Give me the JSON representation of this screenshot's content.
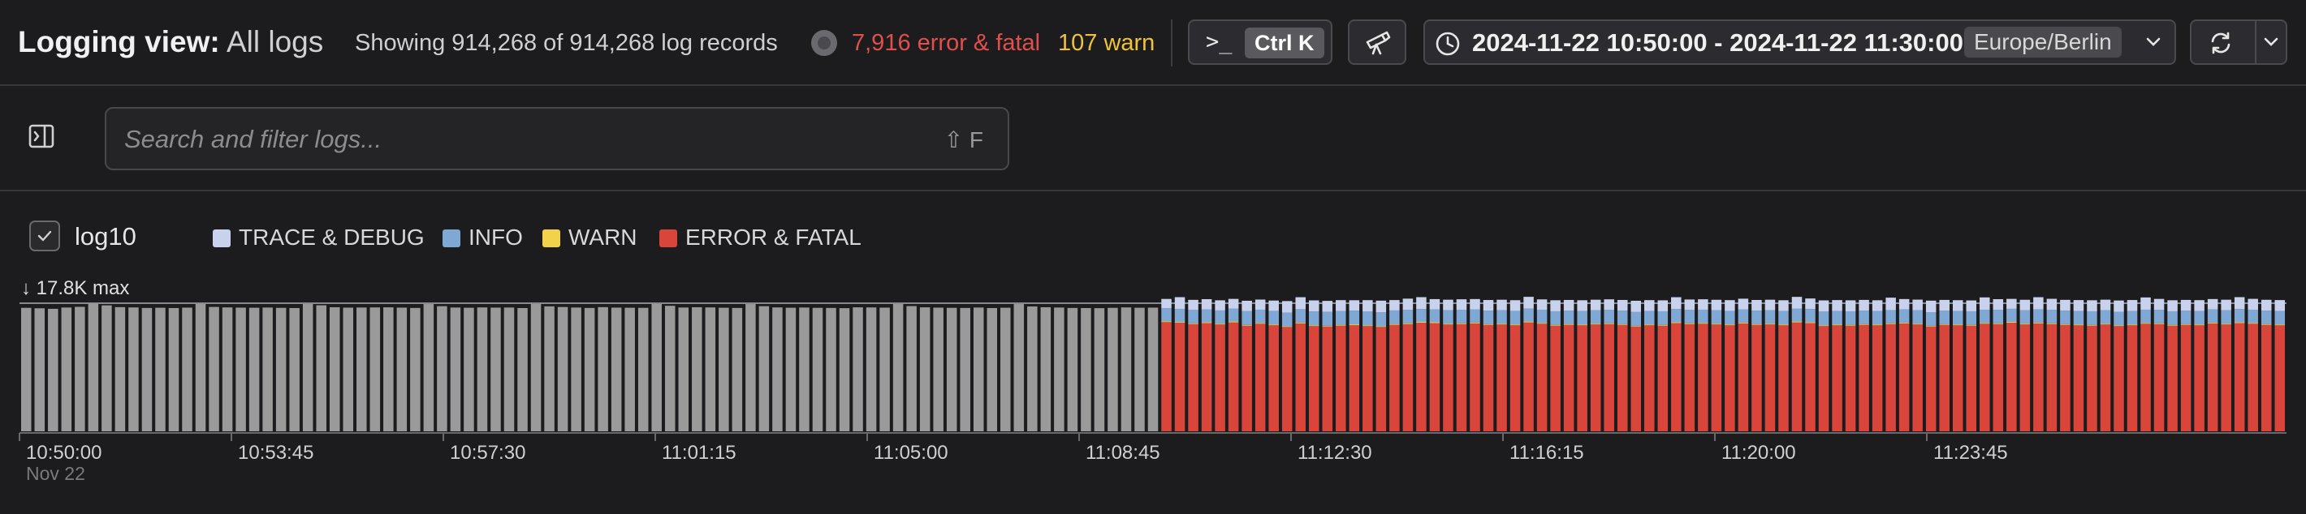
{
  "header": {
    "title_prefix": "Logging view:",
    "title_scope": "All logs",
    "showing_text": "Showing 914,268 of 914,268 log records",
    "error_text": "7,916 error & fatal",
    "warn_text": "107 warn",
    "cmd_prompt": ">_",
    "cmd_shortcut": "Ctrl K",
    "time_range": "2024-11-22 10:50:00 - 2024-11-22 11:30:00",
    "timezone": "Europe/Berlin"
  },
  "search": {
    "placeholder": "Search and filter logs...",
    "shortcut_hint": "⇧ F"
  },
  "icons": {
    "cmd": "terminal-icon",
    "scope": "telescope-icon",
    "time": "clock-icon",
    "refresh": "refresh-icon",
    "dropdown": "chevron-down-icon",
    "panel": "panel-toggle-icon",
    "checkbox": "check-icon"
  },
  "chart_controls": {
    "log10_label": "log10",
    "log10_checked": true,
    "max_label": "↓ 17.8K max"
  },
  "chart_data": {
    "type": "bar",
    "stacked": true,
    "scale": "log10",
    "legend": [
      {
        "name": "TRACE & DEBUG",
        "color": "#c8d2ec"
      },
      {
        "name": "INFO",
        "color": "#7fa8d4"
      },
      {
        "name": "WARN",
        "color": "#f2d24a"
      },
      {
        "name": "ERROR & FATAL",
        "color": "#d9453a"
      }
    ],
    "unlabeled_color": "#9a9a9a",
    "x_ticks": [
      {
        "label": "10:50:00",
        "sublabel": "Nov 22"
      },
      {
        "label": "10:53:45",
        "sublabel": ""
      },
      {
        "label": "10:57:30",
        "sublabel": ""
      },
      {
        "label": "11:01:15",
        "sublabel": ""
      },
      {
        "label": "11:05:00",
        "sublabel": ""
      },
      {
        "label": "11:08:45",
        "sublabel": ""
      },
      {
        "label": "11:12:30",
        "sublabel": ""
      },
      {
        "label": "11:16:15",
        "sublabel": ""
      },
      {
        "label": "11:20:00",
        "sublabel": ""
      },
      {
        "label": "11:23:45",
        "sublabel": ""
      }
    ],
    "x_range": [
      "10:50:00",
      "11:30:00"
    ],
    "y_max": 17800,
    "unlabeled_bars": [
      12500,
      12100,
      11600,
      12800,
      13500,
      17400,
      15100,
      13200,
      12900,
      12400,
      12600,
      12300,
      12700,
      16900,
      13400,
      12900,
      12700,
      12600,
      12800,
      12500,
      12300,
      16800,
      15200,
      13100,
      12700,
      12800,
      12900,
      13000,
      12700,
      12400,
      16700,
      14200,
      12800,
      12600,
      12900,
      12700,
      12800,
      12300,
      16900,
      14000,
      13300,
      12800,
      12400,
      13200,
      12700,
      12600,
      12500,
      16800,
      14600,
      12800,
      13100,
      12900,
      12600,
      12400,
      16700,
      14200,
      12900,
      12600,
      12800,
      12500,
      12400,
      12200,
      13000,
      12900,
      12700,
      16800,
      14300,
      13000,
      12700,
      12500,
      12400,
      12800,
      12300,
      12600,
      16700,
      13900,
      13100,
      12800,
      12400,
      12300,
      12200,
      12500,
      12900,
      12600,
      12700
    ],
    "stacked_bars": [
      {
        "error": 4200,
        "warn": 300,
        "info": 7600,
        "trace": 12600
      },
      {
        "error": 4000,
        "warn": 260,
        "info": 7300,
        "trace": 16700
      },
      {
        "error": 3600,
        "warn": 220,
        "info": 6800,
        "trace": 12400
      },
      {
        "error": 3900,
        "warn": 280,
        "info": 7000,
        "trace": 13100
      },
      {
        "error": 3500,
        "warn": 240,
        "info": 6500,
        "trace": 12000
      },
      {
        "error": 4100,
        "warn": 300,
        "info": 7500,
        "trace": 12900
      },
      {
        "error": 3200,
        "warn": 200,
        "info": 6300,
        "trace": 11800
      },
      {
        "error": 3700,
        "warn": 260,
        "info": 6900,
        "trace": 12700
      },
      {
        "error": 3300,
        "warn": 220,
        "info": 6400,
        "trace": 11900
      },
      {
        "error": 2900,
        "warn": 180,
        "info": 5600,
        "trace": 12300
      },
      {
        "error": 3800,
        "warn": 260,
        "info": 7200,
        "trace": 16900
      },
      {
        "error": 3100,
        "warn": 200,
        "info": 6200,
        "trace": 12600
      },
      {
        "error": 3000,
        "warn": 180,
        "info": 6000,
        "trace": 12100
      },
      {
        "error": 3200,
        "warn": 220,
        "info": 6300,
        "trace": 12800
      },
      {
        "error": 3300,
        "warn": 240,
        "info": 6500,
        "trace": 12300
      },
      {
        "error": 3100,
        "warn": 200,
        "info": 6100,
        "trace": 13100
      },
      {
        "error": 2900,
        "warn": 180,
        "info": 5900,
        "trace": 12700
      },
      {
        "error": 3400,
        "warn": 240,
        "info": 6600,
        "trace": 12400
      },
      {
        "error": 3600,
        "warn": 260,
        "info": 6800,
        "trace": 14600
      },
      {
        "error": 4000,
        "warn": 280,
        "info": 7200,
        "trace": 16800
      },
      {
        "error": 3900,
        "warn": 260,
        "info": 7000,
        "trace": 13200
      },
      {
        "error": 3500,
        "warn": 240,
        "info": 6700,
        "trace": 12900
      },
      {
        "error": 3600,
        "warn": 250,
        "info": 6800,
        "trace": 13400
      },
      {
        "error": 3800,
        "warn": 270,
        "info": 7100,
        "trace": 13300
      },
      {
        "error": 3400,
        "warn": 230,
        "info": 6500,
        "trace": 12600
      },
      {
        "error": 3500,
        "warn": 240,
        "info": 6700,
        "trace": 12800
      },
      {
        "error": 3300,
        "warn": 220,
        "info": 6400,
        "trace": 12500
      },
      {
        "error": 4100,
        "warn": 300,
        "info": 7400,
        "trace": 17200
      },
      {
        "error": 3700,
        "warn": 260,
        "info": 6900,
        "trace": 13000
      },
      {
        "error": 3200,
        "warn": 210,
        "info": 6200,
        "trace": 12700
      },
      {
        "error": 3400,
        "warn": 240,
        "info": 6400,
        "trace": 12800
      },
      {
        "error": 3300,
        "warn": 220,
        "info": 6300,
        "trace": 12500
      },
      {
        "error": 3500,
        "warn": 240,
        "info": 6600,
        "trace": 12900
      },
      {
        "error": 3600,
        "warn": 250,
        "info": 6800,
        "trace": 13300
      },
      {
        "error": 3400,
        "warn": 230,
        "info": 6500,
        "trace": 12700
      },
      {
        "error": 3000,
        "warn": 190,
        "info": 5900,
        "trace": 12400
      },
      {
        "error": 3300,
        "warn": 220,
        "info": 6300,
        "trace": 12700
      },
      {
        "error": 3200,
        "warn": 210,
        "info": 6200,
        "trace": 12600
      },
      {
        "error": 3900,
        "warn": 280,
        "info": 7200,
        "trace": 16800
      },
      {
        "error": 3600,
        "warn": 250,
        "info": 6800,
        "trace": 13000
      },
      {
        "error": 3700,
        "warn": 260,
        "info": 6900,
        "trace": 13200
      },
      {
        "error": 3500,
        "warn": 240,
        "info": 6600,
        "trace": 12800
      },
      {
        "error": 3300,
        "warn": 220,
        "info": 6400,
        "trace": 12600
      },
      {
        "error": 3800,
        "warn": 270,
        "info": 7100,
        "trace": 14000
      },
      {
        "error": 3400,
        "warn": 230,
        "info": 6500,
        "trace": 12700
      },
      {
        "error": 3500,
        "warn": 240,
        "info": 6600,
        "trace": 12900
      },
      {
        "error": 3300,
        "warn": 220,
        "info": 6300,
        "trace": 12500
      },
      {
        "error": 4100,
        "warn": 300,
        "info": 7500,
        "trace": 17000
      },
      {
        "error": 3900,
        "warn": 280,
        "info": 7200,
        "trace": 14200
      },
      {
        "error": 3100,
        "warn": 200,
        "info": 6100,
        "trace": 12700
      },
      {
        "error": 3300,
        "warn": 220,
        "info": 6300,
        "trace": 12800
      },
      {
        "error": 3200,
        "warn": 210,
        "info": 6200,
        "trace": 12600
      },
      {
        "error": 3400,
        "warn": 230,
        "info": 6400,
        "trace": 12900
      },
      {
        "error": 3300,
        "warn": 220,
        "info": 6300,
        "trace": 12500
      },
      {
        "error": 3600,
        "warn": 250,
        "info": 6700,
        "trace": 16700
      },
      {
        "error": 3800,
        "warn": 270,
        "info": 7000,
        "trace": 13400
      },
      {
        "error": 3500,
        "warn": 240,
        "info": 6600,
        "trace": 13100
      },
      {
        "error": 3000,
        "warn": 190,
        "info": 5800,
        "trace": 12700
      },
      {
        "error": 3400,
        "warn": 230,
        "info": 6400,
        "trace": 12900
      },
      {
        "error": 3300,
        "warn": 220,
        "info": 6300,
        "trace": 12600
      },
      {
        "error": 3200,
        "warn": 210,
        "info": 6200,
        "trace": 12400
      },
      {
        "error": 3700,
        "warn": 260,
        "info": 6900,
        "trace": 16900
      },
      {
        "error": 3600,
        "warn": 250,
        "info": 6800,
        "trace": 13600
      },
      {
        "error": 4000,
        "warn": 290,
        "info": 7300,
        "trace": 13200
      },
      {
        "error": 3500,
        "warn": 240,
        "info": 6600,
        "trace": 12800
      },
      {
        "error": 3800,
        "warn": 270,
        "info": 7000,
        "trace": 17100
      },
      {
        "error": 3600,
        "warn": 250,
        "info": 6800,
        "trace": 14300
      },
      {
        "error": 3400,
        "warn": 230,
        "info": 6400,
        "trace": 13000
      },
      {
        "error": 3300,
        "warn": 220,
        "info": 6300,
        "trace": 12800
      },
      {
        "error": 3200,
        "warn": 210,
        "info": 6200,
        "trace": 12700
      },
      {
        "error": 3500,
        "warn": 240,
        "info": 6600,
        "trace": 13000
      },
      {
        "error": 3100,
        "warn": 200,
        "info": 6000,
        "trace": 12600
      },
      {
        "error": 3300,
        "warn": 220,
        "info": 6300,
        "trace": 12900
      },
      {
        "error": 3700,
        "warn": 260,
        "info": 6900,
        "trace": 16800
      },
      {
        "error": 3600,
        "warn": 250,
        "info": 6800,
        "trace": 14100
      },
      {
        "error": 3200,
        "warn": 210,
        "info": 6200,
        "trace": 12700
      },
      {
        "error": 3400,
        "warn": 230,
        "info": 6400,
        "trace": 12900
      },
      {
        "error": 3300,
        "warn": 220,
        "info": 6300,
        "trace": 12700
      },
      {
        "error": 3800,
        "warn": 270,
        "info": 7000,
        "trace": 13400
      },
      {
        "error": 3500,
        "warn": 240,
        "info": 6600,
        "trace": 12900
      },
      {
        "error": 3900,
        "warn": 280,
        "info": 7200,
        "trace": 16900
      },
      {
        "error": 3700,
        "warn": 260,
        "info": 6900,
        "trace": 14000
      },
      {
        "error": 3400,
        "warn": 230,
        "info": 6400,
        "trace": 13100
      },
      {
        "error": 3300,
        "warn": 220,
        "info": 6300,
        "trace": 12800
      }
    ]
  }
}
